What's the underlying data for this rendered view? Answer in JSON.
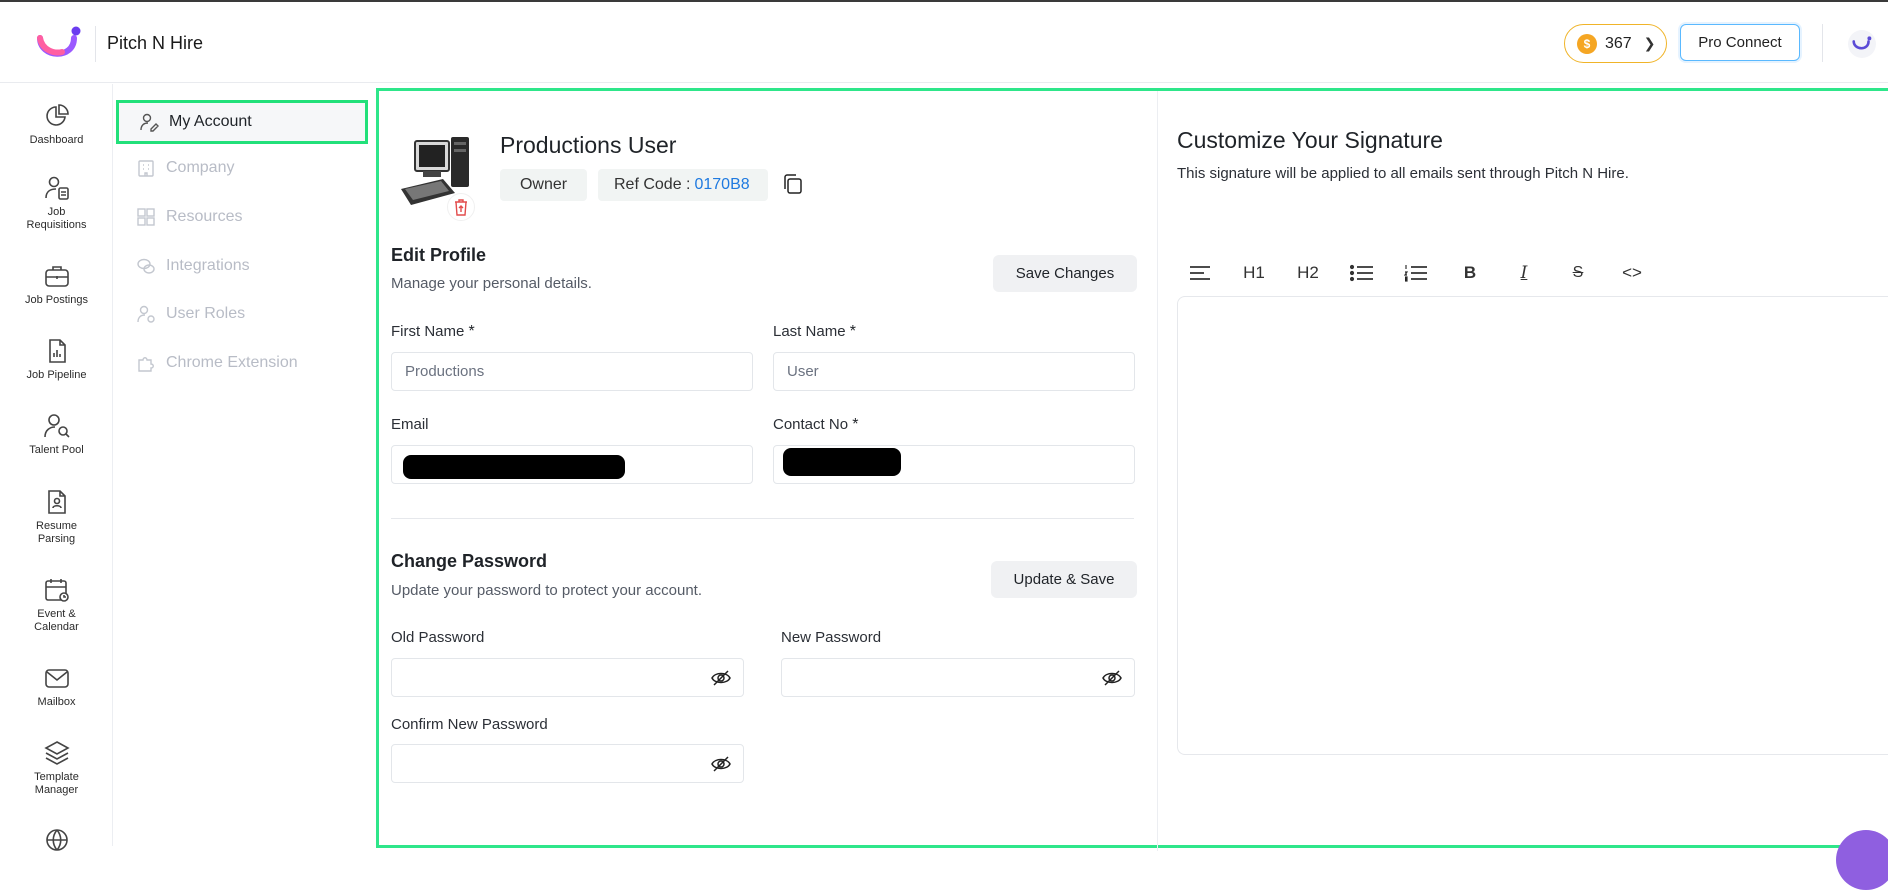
{
  "header": {
    "app_title": "Pitch N Hire",
    "coins": "367",
    "pro_connect": "Pro Connect"
  },
  "nav": [
    {
      "label": "Dashboard",
      "icon": "pie-chart-icon"
    },
    {
      "label": "Job Requisitions",
      "icon": "user-document-icon"
    },
    {
      "label": "Job Postings",
      "icon": "briefcase-icon"
    },
    {
      "label": "Job Pipeline",
      "icon": "pipeline-document-icon"
    },
    {
      "label": "Talent Pool",
      "icon": "user-search-icon"
    },
    {
      "label": "Resume Parsing",
      "icon": "resume-icon"
    },
    {
      "label": "Event & Calendar",
      "icon": "calendar-icon"
    },
    {
      "label": "Mailbox",
      "icon": "mail-icon"
    },
    {
      "label": "Template Manager",
      "icon": "layers-icon"
    }
  ],
  "submenu": [
    {
      "label": "My Account",
      "icon": "user-edit-icon",
      "active": true
    },
    {
      "label": "Company",
      "icon": "building-icon"
    },
    {
      "label": "Resources",
      "icon": "grid-icon"
    },
    {
      "label": "Integrations",
      "icon": "chat-bubbles-icon"
    },
    {
      "label": "User Roles",
      "icon": "user-gear-icon"
    },
    {
      "label": "Chrome Extension",
      "icon": "puzzle-icon"
    }
  ],
  "profile": {
    "name": "Productions User",
    "role": "Owner",
    "ref_label": "Ref Code :",
    "ref_code": "0170B8"
  },
  "edit_profile": {
    "title": "Edit Profile",
    "subtitle": "Manage your personal details.",
    "save_button": "Save Changes",
    "first_name_label": "First Name",
    "first_name_value": "Productions",
    "last_name_label": "Last Name",
    "last_name_value": "User",
    "email_label": "Email",
    "contact_label": "Contact No",
    "required_mark": "*"
  },
  "change_password": {
    "title": "Change Password",
    "subtitle": "Update your password to protect your account.",
    "update_button": "Update & Save",
    "old_label": "Old Password",
    "new_label": "New Password",
    "confirm_label": "Confirm New Password"
  },
  "signature": {
    "title": "Customize Your Signature",
    "subtitle": "This signature will be applied to all emails sent through Pitch N Hire.",
    "toolbar": {
      "h1": "H1",
      "h2": "H2",
      "bold": "B",
      "italic": "I",
      "strike": "S",
      "code": "<>"
    }
  },
  "colors": {
    "active_outline": "#22e07a",
    "ref_code": "#1f7ae0",
    "coin": "#f5a623"
  }
}
